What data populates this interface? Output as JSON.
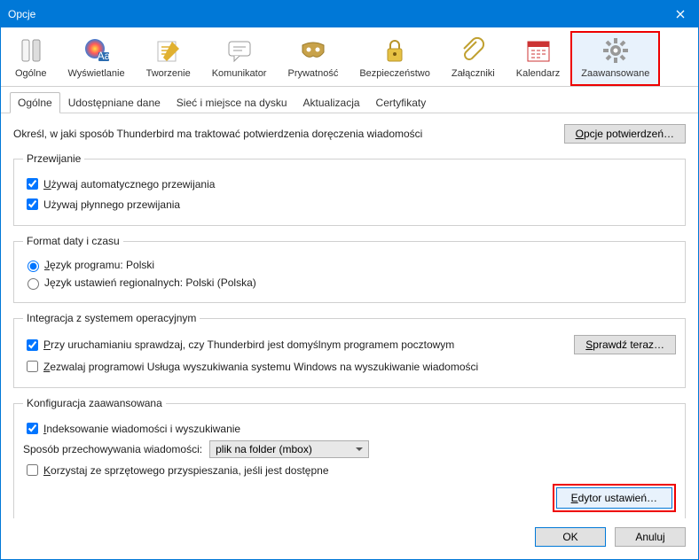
{
  "window": {
    "title": "Opcje"
  },
  "toolbar": {
    "items": [
      {
        "label": "Ogólne"
      },
      {
        "label": "Wyświetlanie"
      },
      {
        "label": "Tworzenie"
      },
      {
        "label": "Komunikator"
      },
      {
        "label": "Prywatność"
      },
      {
        "label": "Bezpieczeństwo"
      },
      {
        "label": "Załączniki"
      },
      {
        "label": "Kalendarz"
      },
      {
        "label": "Zaawansowane"
      }
    ]
  },
  "tabs": [
    "Ogólne",
    "Udostępniane dane",
    "Sieć i miejsce na dysku",
    "Aktualizacja",
    "Certyfikaty"
  ],
  "desc": "Określ, w jaki sposób Thunderbird ma traktować potwierdzenia doręczenia wiadomości",
  "btn_receipts": "Opcje potwierdzeń…",
  "scrolling": {
    "legend": "Przewijanie",
    "auto": "żywaj automatycznego przewijania",
    "smooth": "Używaj płynnego przewijania"
  },
  "date": {
    "legend": "Format daty i czasu",
    "program": "ęzyk programu: Polski",
    "regional": "Język ustawień regionalnych: Polski (Polska)"
  },
  "integration": {
    "legend": "Integracja z systemem operacyjnym",
    "default_client": "rzy uruchamianiu sprawdzaj, czy Thunderbird jest domyślnym programem pocztowym",
    "check_now": "prawdź teraz…",
    "allow_search": "ezwalaj programowi Usługa wyszukiwania systemu Windows na wyszukiwanie wiadomości"
  },
  "advanced": {
    "legend": "Konfiguracja zaawansowana",
    "indexing": "ndeksowanie wiadomości i wyszukiwanie",
    "storage_label": "Sposób przechowywania wiadomości:",
    "storage_value": "plik na folder (mbox)",
    "hw_accel": "orzystaj ze sprzętowego przyspieszania, jeśli jest dostępne",
    "editor": "dytor ustawień…"
  },
  "footer": {
    "ok": "OK",
    "cancel": "Anuluj"
  }
}
